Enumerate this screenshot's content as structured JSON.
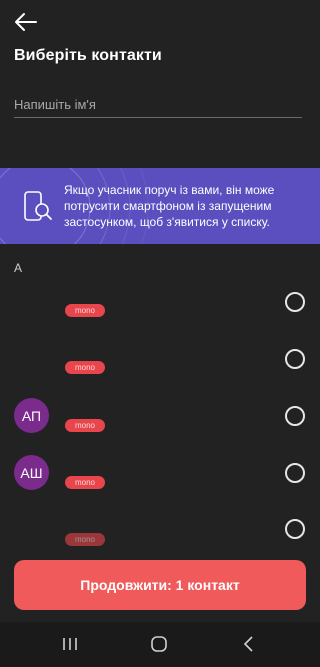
{
  "header": {
    "back_icon": "arrow-left-icon",
    "title": "Виберіть контакти"
  },
  "search": {
    "placeholder": "Напишіть ім'я",
    "value": ""
  },
  "banner": {
    "icon": "phone-search-icon",
    "text": "Якщо учасник поруч із вами, він може потрусити смартфоном із запущеним застосунком, щоб з'явитися у списку.",
    "color": "#5b4fbf"
  },
  "section": {
    "letter": "А"
  },
  "contacts": [
    {
      "initials": "",
      "badge": "mono",
      "selected": false
    },
    {
      "initials": "",
      "badge": "mono",
      "selected": false
    },
    {
      "initials": "АП",
      "badge": "mono",
      "selected": false
    },
    {
      "initials": "АШ",
      "badge": "mono",
      "selected": false
    },
    {
      "initials": "",
      "badge": "mono",
      "selected": false
    }
  ],
  "footer": {
    "continue_label": "Продовжити: 1 контакт",
    "accent": "#f05a5a"
  },
  "navbar": {
    "items": [
      "recent-apps-icon",
      "home-icon",
      "back-icon"
    ]
  }
}
